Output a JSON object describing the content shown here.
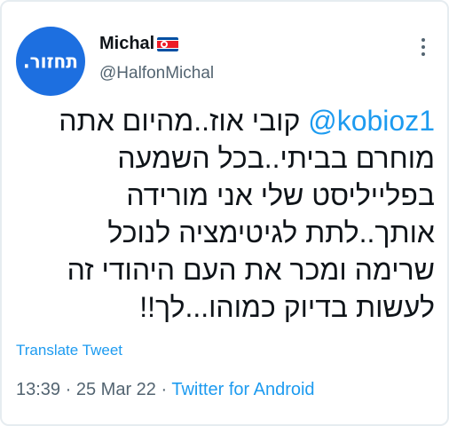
{
  "tweet": {
    "avatar_logo": "תחזור.",
    "display_name": "Michal",
    "flag_icon": "north-korea-flag-icon",
    "handle": "@HalfonMichal",
    "more_icon": "more-vertical-icon",
    "mention": "@kobioz1",
    "text_line1": "קובי אוז..מהיום אתה",
    "text_rest": "מוחרם בביתי..בכל השמעה\nבפלייליסט שלי אני מורידה\nאותך..לתת לגיטימציה לנוכל\nשרימה ומכר את העם היהודי זה\nלעשות בדיוק כמוהו...לך!!",
    "translate_label": "Translate Tweet",
    "time": "13:39",
    "separator": "·",
    "date": "25 Mar 22",
    "source": "Twitter for Android"
  },
  "colors": {
    "accent": "#1d9bf0",
    "text": "#0f1419",
    "secondary": "#536471",
    "avatar_bg": "#1d6fe0"
  }
}
